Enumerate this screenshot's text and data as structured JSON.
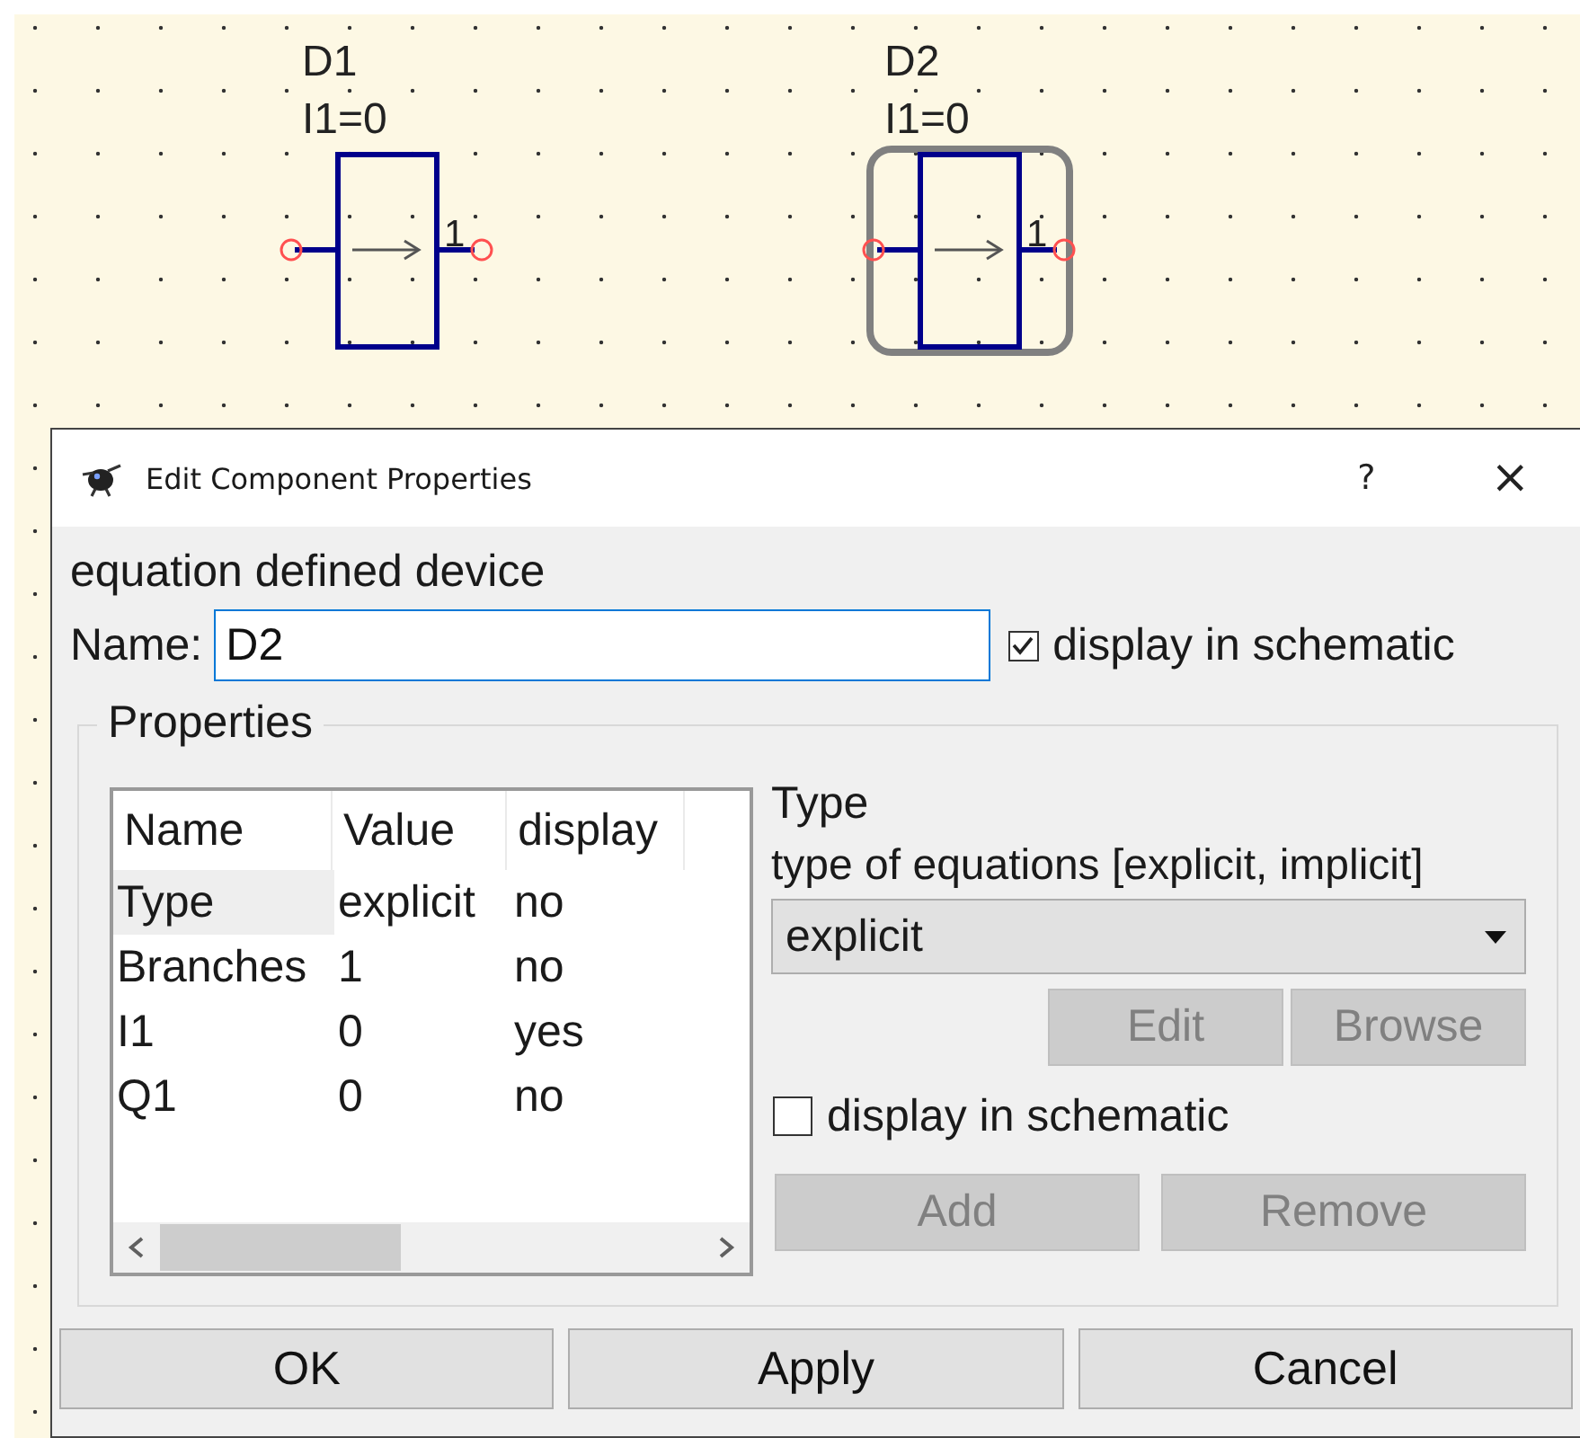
{
  "schematic": {
    "components": [
      {
        "name": "D1",
        "label": "I1=0",
        "pin_label": "1",
        "selected": false
      },
      {
        "name": "D2",
        "label": "I1=0",
        "pin_label": "1",
        "selected": true
      }
    ]
  },
  "dialog": {
    "title": "Edit Component Properties",
    "help_button": "?",
    "close_button": "×",
    "description": "equation defined device",
    "name_field": {
      "label": "Name:",
      "value": "D2"
    },
    "display_checkbox": {
      "label": "display in schematic",
      "checked": true
    },
    "properties": {
      "title": "Properties",
      "table": {
        "columns": [
          "Name",
          "Value",
          "display"
        ],
        "rows": [
          {
            "cells": [
              "Type",
              "explicit",
              "no"
            ],
            "selected": true
          },
          {
            "cells": [
              "Branches",
              "1",
              "no"
            ],
            "selected": false
          },
          {
            "cells": [
              "I1",
              "0",
              "yes"
            ],
            "selected": false
          },
          {
            "cells": [
              "Q1",
              "0",
              "no"
            ],
            "selected": false
          }
        ]
      },
      "editor": {
        "title": "Type",
        "description": "type of equations [explicit, implicit]",
        "dropdown_value": "explicit",
        "buttons": [
          {
            "label": "Edit",
            "disabled": true
          },
          {
            "label": "Browse",
            "disabled": true
          }
        ],
        "display_checkbox": {
          "label": "display in schematic",
          "checked": false
        },
        "list_buttons": [
          {
            "label": "Add",
            "disabled": true
          },
          {
            "label": "Remove",
            "disabled": true
          }
        ]
      }
    },
    "buttons": [
      {
        "label": "OK",
        "disabled": false
      },
      {
        "label": "Apply",
        "disabled": false
      },
      {
        "label": "Cancel",
        "disabled": false
      }
    ]
  }
}
